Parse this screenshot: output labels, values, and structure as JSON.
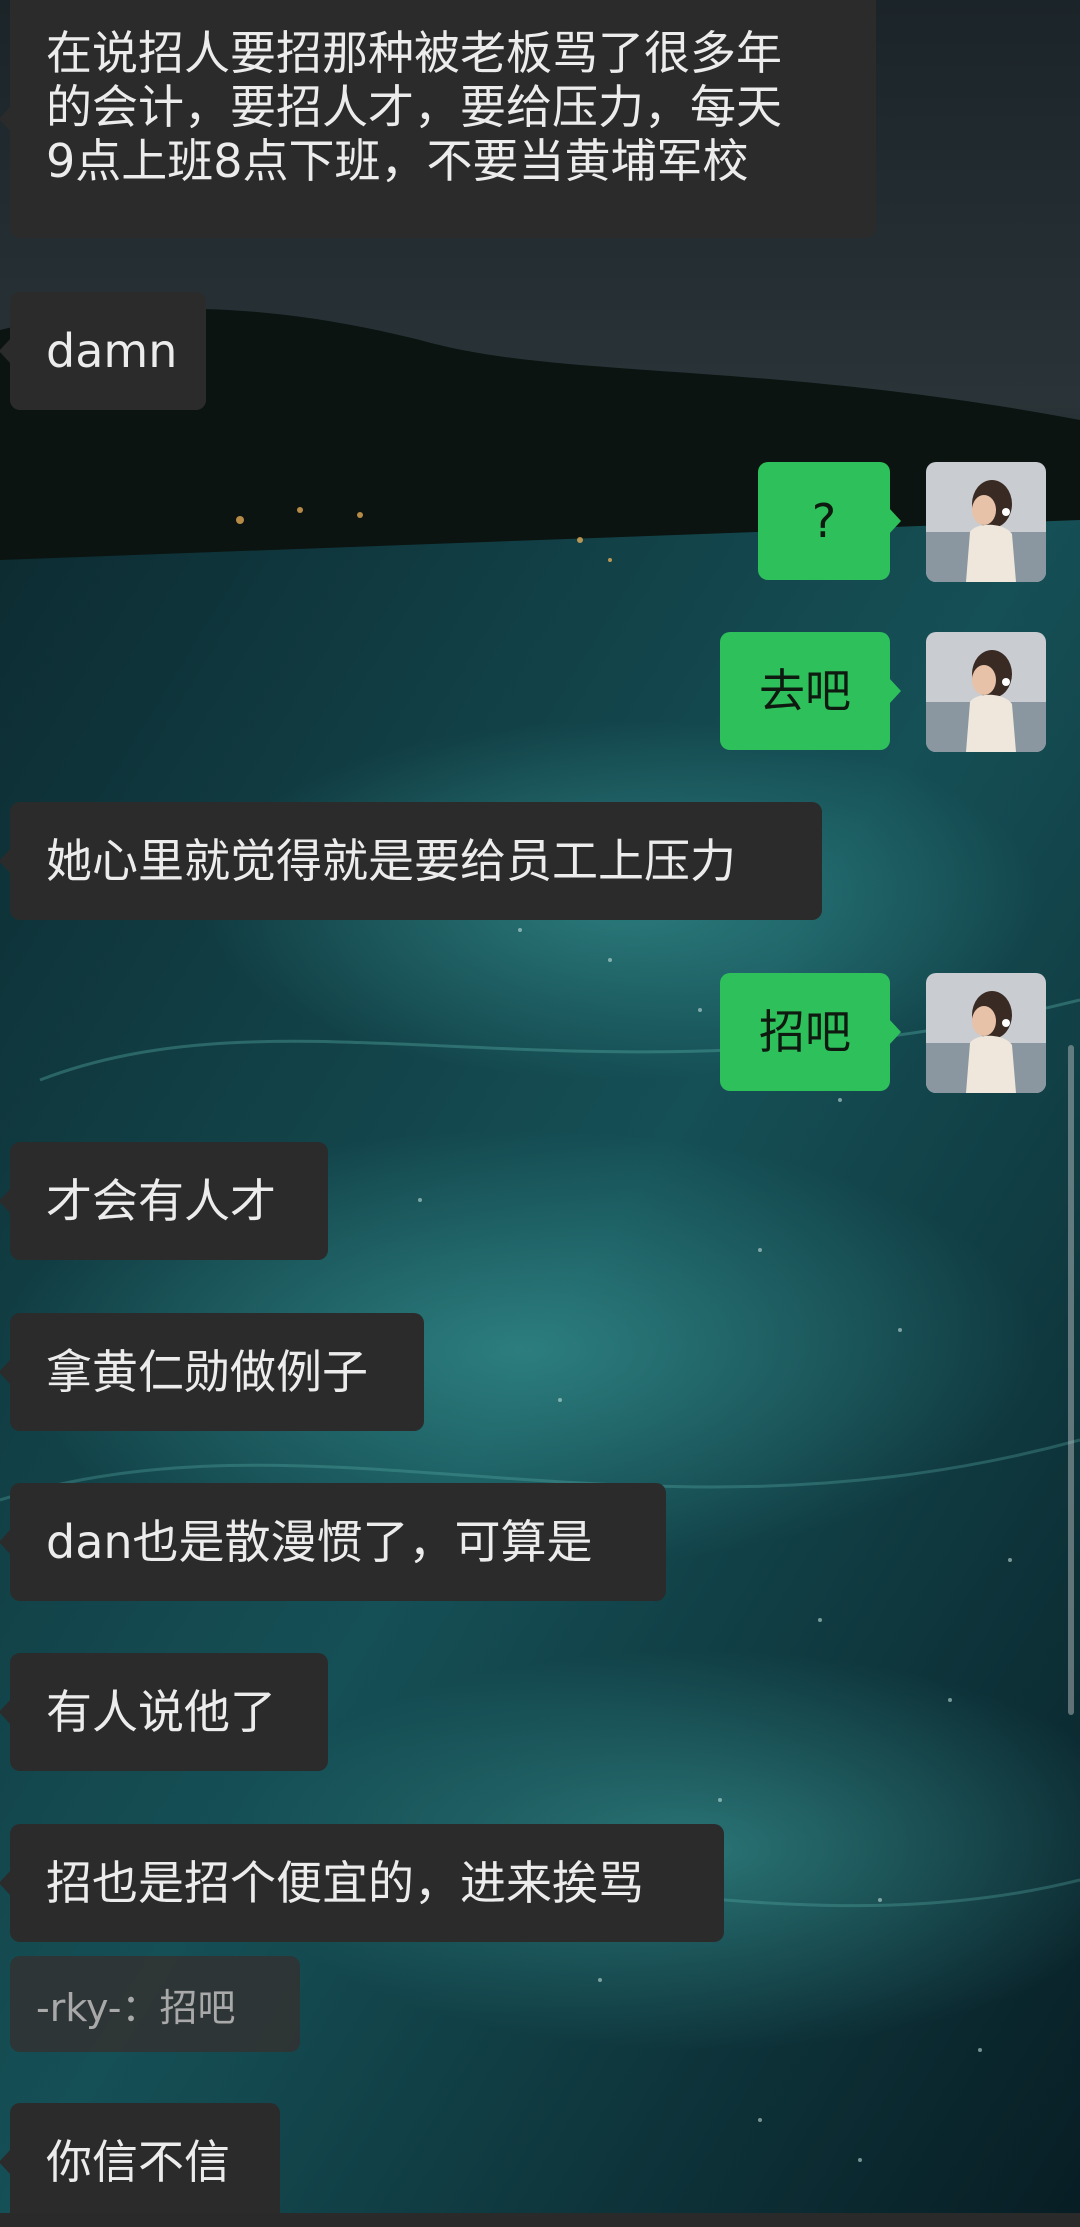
{
  "messages": [
    {
      "side": "in",
      "lines": [
        "在说招人要招那种被老板骂了很多年",
        "的会计，要招人才，要给压力，每天",
        "9点上班8点下班，不要当黄埔军校"
      ]
    },
    {
      "side": "in",
      "text": "damn"
    },
    {
      "side": "out",
      "text": "?"
    },
    {
      "side": "out",
      "text": "去吧"
    },
    {
      "side": "in",
      "text": "她心里就觉得就是要给员工上压力"
    },
    {
      "side": "out",
      "text": "招吧"
    },
    {
      "side": "in",
      "text": "才会有人才"
    },
    {
      "side": "in",
      "text": "拿黄仁勋做例子"
    },
    {
      "side": "in",
      "text": "dan也是散漫惯了，可算是"
    },
    {
      "side": "in",
      "text": "有人说他了"
    },
    {
      "side": "in",
      "text": "招也是招个便宜的，进来挨骂"
    },
    {
      "side": "in",
      "text": "你信不信"
    }
  ],
  "quote": {
    "text": "-rky-：招吧"
  },
  "colors": {
    "incoming_bubble": "#2b2b2b",
    "outgoing_bubble": "#2ec05b",
    "incoming_text": "#ececec",
    "outgoing_text": "#0e1a10"
  },
  "icons": {
    "avatar": "user-avatar-photo"
  }
}
